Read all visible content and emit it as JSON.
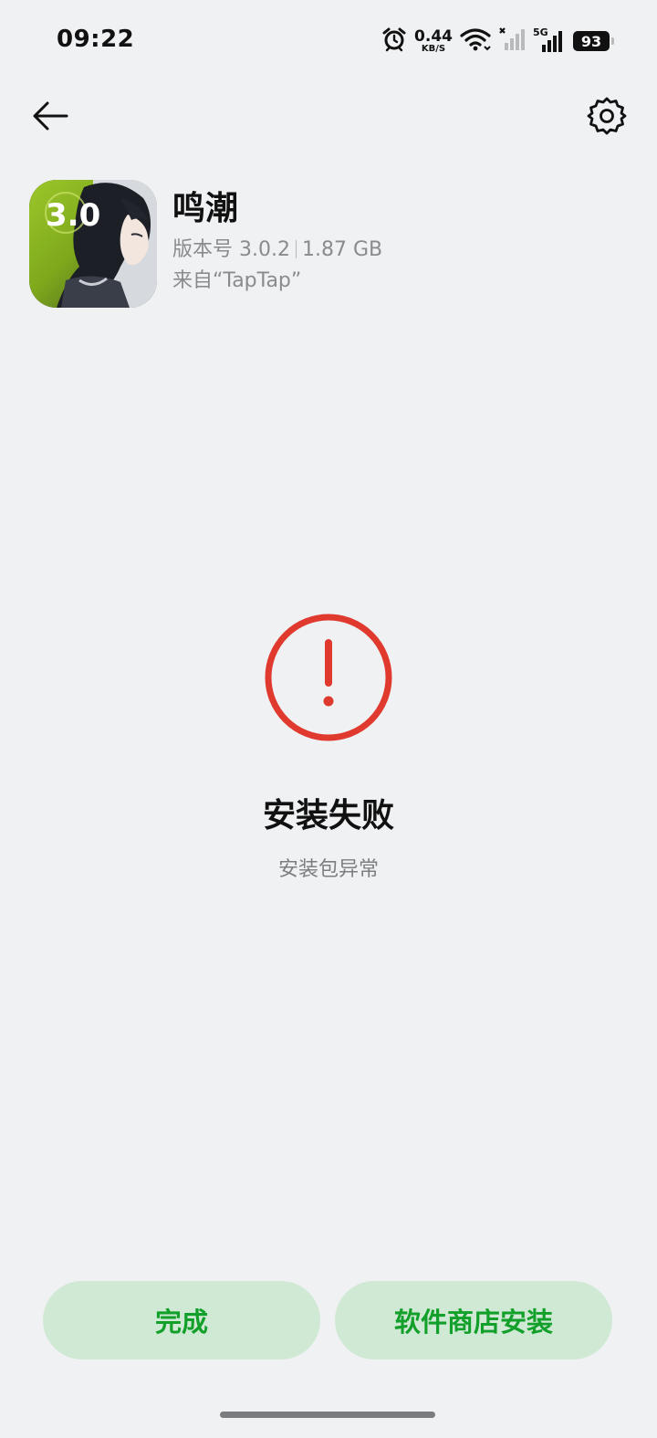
{
  "status_bar": {
    "time": "09:22",
    "net_speed_value": "0.44",
    "net_speed_unit": "KB/S",
    "network_type": "5G",
    "battery": "93"
  },
  "nav": {
    "back_icon": "arrow-left-icon",
    "settings_icon": "gear-icon"
  },
  "app": {
    "name": "鸣潮",
    "version": "版本号 3.0.2",
    "size": "1.87 GB",
    "source": "来自“TapTap”",
    "icon_badge": "3.0",
    "icon_accent_color": "#8fbe1a"
  },
  "result": {
    "icon": "error-exclamation-icon",
    "icon_color": "#e03a2f",
    "title": "安装失败",
    "description": "安装包异常"
  },
  "actions": {
    "done_label": "完成",
    "store_install_label": "软件商店安装",
    "button_color": "#cfe9d4",
    "button_text_color": "#12a02a"
  }
}
